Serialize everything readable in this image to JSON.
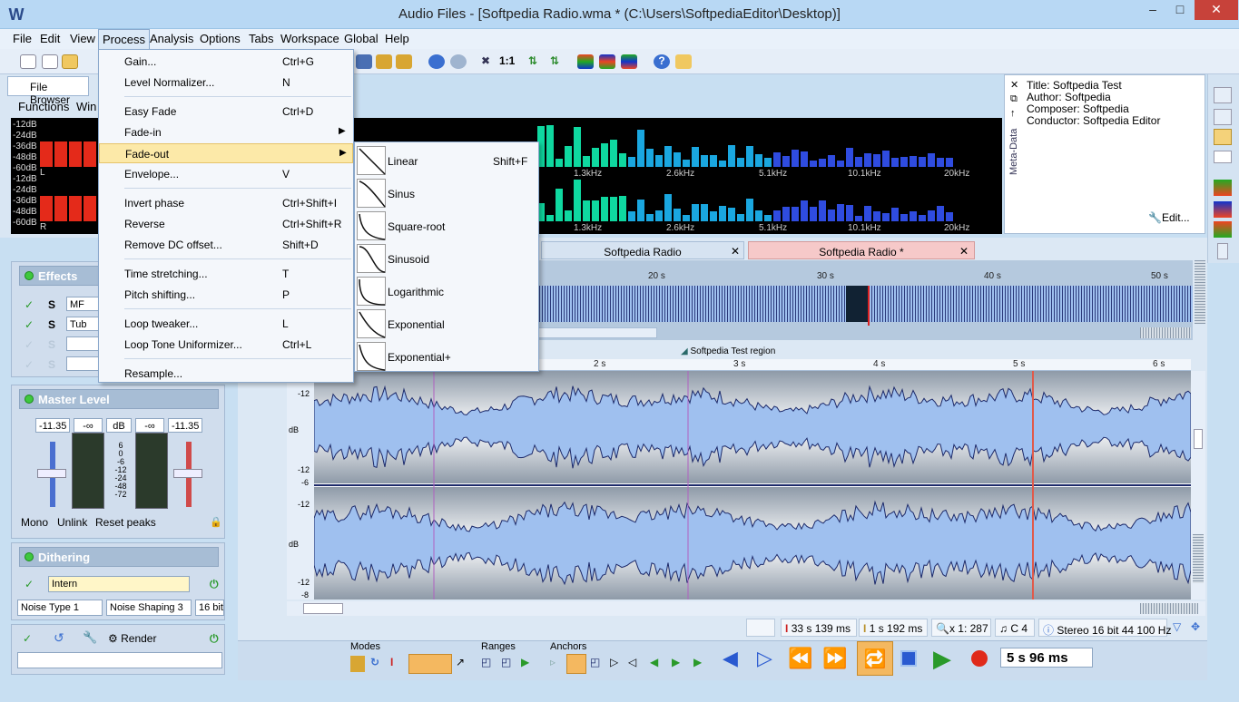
{
  "window": {
    "title": "Audio Files - [Softpedia Radio.wma * (C:\\Users\\SoftpediaEditor\\Desktop)]"
  },
  "menu": [
    "File",
    "Edit",
    "View",
    "Process",
    "Analysis",
    "Options",
    "Tabs",
    "Workspace",
    "Global",
    "Help"
  ],
  "toolbar": {
    "zoom_label": "1:1"
  },
  "left_tab": {
    "label": "File Browser"
  },
  "functions_label": "Functions",
  "functions_label_cut": "Win",
  "meter": {
    "db_top": [
      "-12dB",
      "-24dB",
      "-36dB",
      "-48dB",
      "-60dB"
    ],
    "db_bottom": [
      "-12dB",
      "-24dB",
      "-36dB",
      "-48dB",
      "-60dB"
    ],
    "ch_left": "L",
    "ch_right": "R",
    "freqs": [
      "1.3kHz",
      "2.6kHz",
      "5.1kHz",
      "10.1kHz",
      "20kHz"
    ]
  },
  "metadata": {
    "panel_title": "Meta-Data",
    "lines": [
      {
        "key": "Title:",
        "value": "Softpedia Test"
      },
      {
        "key": "Author:",
        "value": "Softpedia"
      },
      {
        "key": "Composer:",
        "value": "Softpedia"
      },
      {
        "key": "Conductor:",
        "value": "Softpedia Editor"
      }
    ],
    "edit_label": "Edit..."
  },
  "effects": {
    "title": "Effects",
    "rows": [
      {
        "name": "MF"
      },
      {
        "name": "Tub"
      },
      {
        "name": ""
      },
      {
        "name": ""
      }
    ],
    "s_label": "S"
  },
  "master": {
    "title": "Master Level",
    "left_value": "-11.35",
    "inf_left": "-∞",
    "db_label": "dB",
    "inf_right": "-∞",
    "right_value": "-11.35",
    "scale": [
      "6",
      "0",
      "-6",
      "-12",
      "-24",
      "-48",
      "-72"
    ],
    "buttons": [
      "Mono",
      "Unlink",
      "Reset peaks"
    ]
  },
  "dithering": {
    "title": "Dithering",
    "mode": "Intern",
    "noise_type": "Noise Type 1",
    "noise_shaping": "Noise Shaping 3",
    "bits": "16 bit"
  },
  "render": {
    "label": "Render"
  },
  "doc_tabs": [
    {
      "label": "Softpedia Radio",
      "active": false
    },
    {
      "label": "Softpedia Radio *",
      "active": true
    }
  ],
  "overview_ruler": [
    "20 s",
    "30 s",
    "40 s",
    "50 s"
  ],
  "region_label": "Softpedia Test region",
  "main_ruler": [
    "2 s",
    "3 s",
    "4 s",
    "5 s",
    "6 s"
  ],
  "wave_db": {
    "top": [
      "-12",
      "dB",
      "-12",
      "-6"
    ],
    "bottom": [
      "-12",
      "dB",
      "-12",
      "-8"
    ]
  },
  "status": {
    "position": "33 s 139 ms",
    "length": "1 s 192 ms",
    "zoom": "x 1: 287",
    "note": "C 4",
    "format": "Stereo 16 bit 44 100 Hz"
  },
  "bottom_groups": {
    "modes": "Modes",
    "ranges": "Ranges",
    "anchors": "Anchors"
  },
  "time_display": "5 s 96 ms",
  "process_menu": [
    {
      "label": "Gain...",
      "shortcut": "Ctrl+G",
      "sep_after": false
    },
    {
      "label": "Level Normalizer...",
      "shortcut": "N",
      "sep_after": true
    },
    {
      "label": "Easy Fade",
      "shortcut": "Ctrl+D",
      "sep_after": false
    },
    {
      "label": "Fade-in",
      "shortcut": "",
      "submenu": true,
      "sep_after": false
    },
    {
      "label": "Fade-out",
      "shortcut": "",
      "submenu": true,
      "highlighted": true,
      "sep_after": false
    },
    {
      "label": "Envelope...",
      "shortcut": "V",
      "sep_after": true
    },
    {
      "label": "Invert phase",
      "shortcut": "Ctrl+Shift+I",
      "sep_after": false
    },
    {
      "label": "Reverse",
      "shortcut": "Ctrl+Shift+R",
      "sep_after": false
    },
    {
      "label": "Remove DC offset...",
      "shortcut": "Shift+D",
      "sep_after": true
    },
    {
      "label": "Time stretching...",
      "shortcut": "T",
      "sep_after": false
    },
    {
      "label": "Pitch shifting...",
      "shortcut": "P",
      "sep_after": true
    },
    {
      "label": "Loop tweaker...",
      "shortcut": "L",
      "sep_after": false
    },
    {
      "label": "Loop Tone Uniformizer...",
      "shortcut": "Ctrl+L",
      "sep_after": true
    },
    {
      "label": "Resample...",
      "shortcut": "",
      "sep_after": false
    }
  ],
  "fadeout_submenu": [
    {
      "label": "Linear",
      "shortcut": "Shift+F"
    },
    {
      "label": "Sinus",
      "shortcut": ""
    },
    {
      "label": "Square-root",
      "shortcut": ""
    },
    {
      "label": "Sinusoid",
      "shortcut": ""
    },
    {
      "label": "Logarithmic",
      "shortcut": ""
    },
    {
      "label": "Exponential",
      "shortcut": ""
    },
    {
      "label": "Exponential+",
      "shortcut": ""
    }
  ],
  "colors": {
    "accent": "#fce9a8",
    "wave": "#9fc0ef",
    "wave_line": "#1d2a6a",
    "spectrum_low": "#e42a1a",
    "spectrum_mid": "#1aa7e0",
    "spectrum_high": "#2f4ce0"
  }
}
